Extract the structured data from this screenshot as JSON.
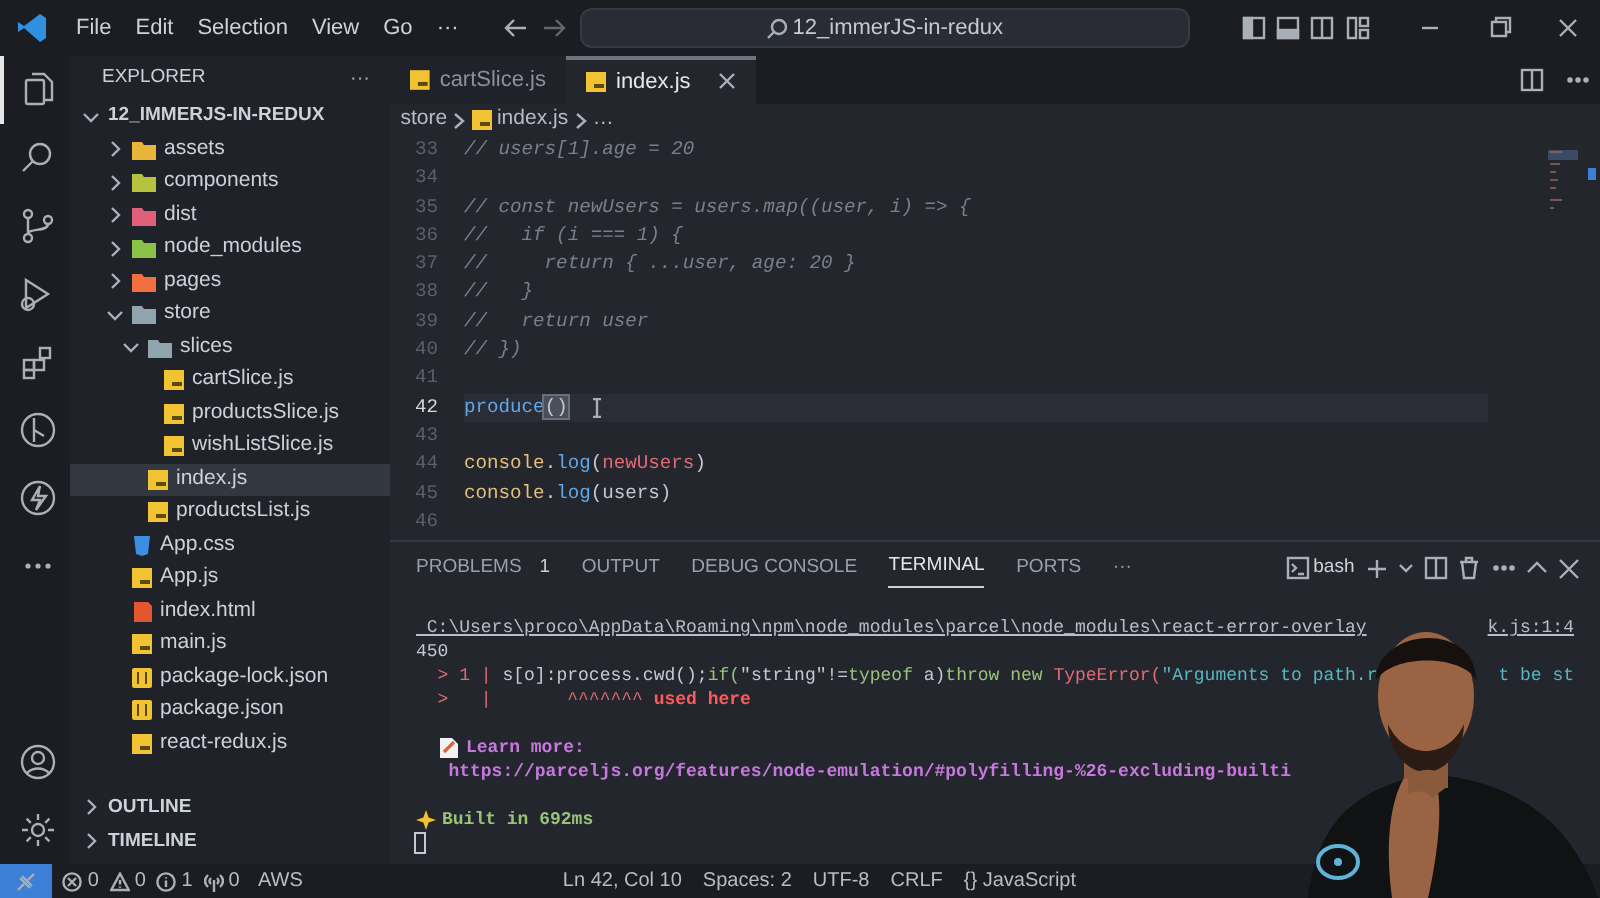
{
  "title_bar": {
    "menu": [
      "File",
      "Edit",
      "Selection",
      "View",
      "Go",
      "···"
    ],
    "search": "12_immerJS-in-redux"
  },
  "activity_bar": [
    {
      "kind": "explorer",
      "selected": true
    },
    {
      "kind": "search",
      "selected": false
    },
    {
      "kind": "source-control",
      "selected": false
    },
    {
      "kind": "run",
      "selected": false
    },
    {
      "kind": "extensions",
      "selected": false
    },
    {
      "kind": "git-graph",
      "selected": false
    },
    {
      "kind": "lightning",
      "selected": false
    },
    {
      "kind": "more",
      "selected": false
    }
  ],
  "activity_bottom": [
    {
      "kind": "account"
    },
    {
      "kind": "settings"
    }
  ],
  "explorer": {
    "title": "EXPLORER",
    "more": "···",
    "root": {
      "label": "12_IMMERJS-IN-REDUX",
      "expanded": true,
      "children": [
        {
          "label": "assets",
          "kind": "folder",
          "color": "#e8b43a",
          "expanded": false,
          "selected": false
        },
        {
          "label": "components",
          "kind": "folder",
          "color": "#b5c43c",
          "expanded": false,
          "selected": false
        },
        {
          "label": "dist",
          "kind": "folder",
          "color": "#e0607a",
          "expanded": false,
          "selected": false
        },
        {
          "label": "node_modules",
          "kind": "folder",
          "color": "#8bc34a",
          "expanded": false,
          "selected": false
        },
        {
          "label": "pages",
          "kind": "folder",
          "color": "#f07040",
          "expanded": false,
          "selected": false
        },
        {
          "label": "store",
          "kind": "folder",
          "color": "#90a4ae",
          "expanded": true,
          "selected": false,
          "children": [
            {
              "label": "slices",
              "kind": "folder",
              "color": "#90a4ae",
              "expanded": true,
              "selected": false,
              "children": [
                {
                  "label": "cartSlice.js",
                  "kind": "js",
                  "selected": false
                },
                {
                  "label": "productsSlice.js",
                  "kind": "js",
                  "selected": false
                },
                {
                  "label": "wishListSlice.js",
                  "kind": "js",
                  "selected": false
                }
              ]
            },
            {
              "label": "index.js",
              "kind": "js",
              "selected": true
            },
            {
              "label": "productsList.js",
              "kind": "js",
              "selected": false
            }
          ]
        },
        {
          "label": "App.css",
          "kind": "css",
          "selected": false
        },
        {
          "label": "App.js",
          "kind": "js",
          "selected": false
        },
        {
          "label": "index.html",
          "kind": "html",
          "selected": false
        },
        {
          "label": "main.js",
          "kind": "js",
          "selected": false
        },
        {
          "label": "package-lock.json",
          "kind": "json",
          "selected": false
        },
        {
          "label": "package.json",
          "kind": "json",
          "selected": false
        },
        {
          "label": "react-redux.js",
          "kind": "js",
          "selected": false
        }
      ]
    },
    "sections": [
      {
        "label": "OUTLINE",
        "expanded": false
      },
      {
        "label": "TIMELINE",
        "expanded": false
      }
    ]
  },
  "tabs": [
    {
      "label": "cartSlice.js",
      "selected": false
    },
    {
      "label": "index.js",
      "selected": true
    }
  ],
  "breadcrumb": [
    "store",
    "index.js",
    "…"
  ],
  "code": [
    {
      "num": "33",
      "current": false,
      "segments": [
        {
          "kind": "comment",
          "text": "// users[1].age = 20"
        }
      ]
    },
    {
      "num": "34",
      "current": false
    },
    {
      "num": "35",
      "current": false,
      "segments": [
        {
          "kind": "comment",
          "text": "// const newUsers = users.map((user, i) => {"
        }
      ]
    },
    {
      "num": "36",
      "current": false,
      "segments": [
        {
          "kind": "comment",
          "text": "//   if (i === 1) {"
        }
      ]
    },
    {
      "num": "37",
      "current": false,
      "segments": [
        {
          "kind": "comment",
          "text": "//     return { ...user, age: 20 }"
        }
      ]
    },
    {
      "num": "38",
      "current": false,
      "segments": [
        {
          "kind": "comment",
          "text": "//   }"
        }
      ]
    },
    {
      "num": "39",
      "current": false,
      "segments": [
        {
          "kind": "comment",
          "text": "//   return user"
        }
      ]
    },
    {
      "num": "40",
      "current": false,
      "segments": [
        {
          "kind": "comment",
          "text": "// })"
        }
      ]
    },
    {
      "num": "41",
      "current": false
    },
    {
      "num": "42",
      "current": true,
      "segments": [
        {
          "kind": "fn",
          "text": "produce"
        },
        {
          "kind": "match",
          "text": "()"
        }
      ]
    },
    {
      "num": "43",
      "current": false
    },
    {
      "num": "44",
      "current": false,
      "segments": [
        {
          "kind": "obj",
          "text": "console"
        },
        {
          "kind": "plain",
          "text": "."
        },
        {
          "kind": "fn",
          "text": "log"
        },
        {
          "kind": "plain",
          "text": "("
        },
        {
          "kind": "var",
          "text": "newUsers"
        },
        {
          "kind": "plain",
          "text": ")"
        }
      ]
    },
    {
      "num": "45",
      "current": false,
      "segments": [
        {
          "kind": "obj",
          "text": "console"
        },
        {
          "kind": "plain",
          "text": "."
        },
        {
          "kind": "fn",
          "text": "log"
        },
        {
          "kind": "plain",
          "text": "(users)"
        }
      ]
    },
    {
      "num": "46",
      "current": false
    }
  ],
  "panel": {
    "tabs": [
      {
        "label": "PROBLEMS",
        "badge": "1",
        "selected": false
      },
      {
        "label": "OUTPUT",
        "selected": false
      },
      {
        "label": "DEBUG CONSOLE",
        "selected": false
      },
      {
        "label": "TERMINAL",
        "selected": true
      },
      {
        "label": "PORTS",
        "selected": false
      }
    ],
    "more": "···",
    "shell": "bash"
  },
  "terminal": [
    {
      "kind": "blank"
    },
    {
      "segments": [
        {
          "kind": "path",
          "text": " C:\\Users\\proco\\AppData\\Roaming\\npm\\node_modules\\parcel\\node_modules\\react-error-overlay"
        }
      ],
      "right": [
        {
          "kind": "path",
          "text": "k.js:1:4"
        }
      ]
    },
    {
      "segments": [
        {
          "kind": "plain",
          "text": "450"
        }
      ]
    },
    {
      "segments": [
        {
          "kind": "marker",
          "text": "  > 1 | "
        },
        {
          "kind": "plain",
          "text": "s[o]:process.cwd();"
        },
        {
          "kind": "kw",
          "text": "if("
        },
        {
          "kind": "plain",
          "text": "\"string\"!="
        },
        {
          "kind": "kw",
          "text": "typeof"
        },
        {
          "kind": "plain",
          "text": " a)"
        },
        {
          "kind": "kw",
          "text": "throw new "
        },
        {
          "kind": "err",
          "text": "TypeError("
        },
        {
          "kind": "str",
          "text": "\"Arguments to path.r"
        }
      ],
      "right": [
        {
          "kind": "str",
          "text": "t be st"
        }
      ]
    },
    {
      "segments": [
        {
          "kind": "marker",
          "text": "  >   |       ^^^^^^^ "
        },
        {
          "kind": "used",
          "text": "used here"
        }
      ]
    },
    {
      "kind": "blank"
    },
    {
      "kind": "note",
      "segments": [
        {
          "kind": "link",
          "text": "Learn more:"
        }
      ]
    },
    {
      "segments": [
        {
          "kind": "link",
          "text": "   https://parceljs.org/features/node-emulation/#polyfilling-%26-excluding-builti"
        }
      ]
    },
    {
      "kind": "blank"
    },
    {
      "kind": "sparkle",
      "segments": [
        {
          "kind": "success",
          "text": "Built in 692ms"
        }
      ]
    }
  ],
  "status_bar": {
    "left": [
      {
        "kind": "errors",
        "text": "0"
      },
      {
        "kind": "warnings",
        "text": "0"
      },
      {
        "kind": "info",
        "text": "1"
      },
      {
        "kind": "ports",
        "text": "0"
      },
      {
        "kind": "plain",
        "text": "AWS"
      }
    ],
    "right": [
      "Ln 42, Col 10",
      "Spaces: 2",
      "UTF-8",
      "CRLF",
      "{} JavaScript"
    ]
  }
}
